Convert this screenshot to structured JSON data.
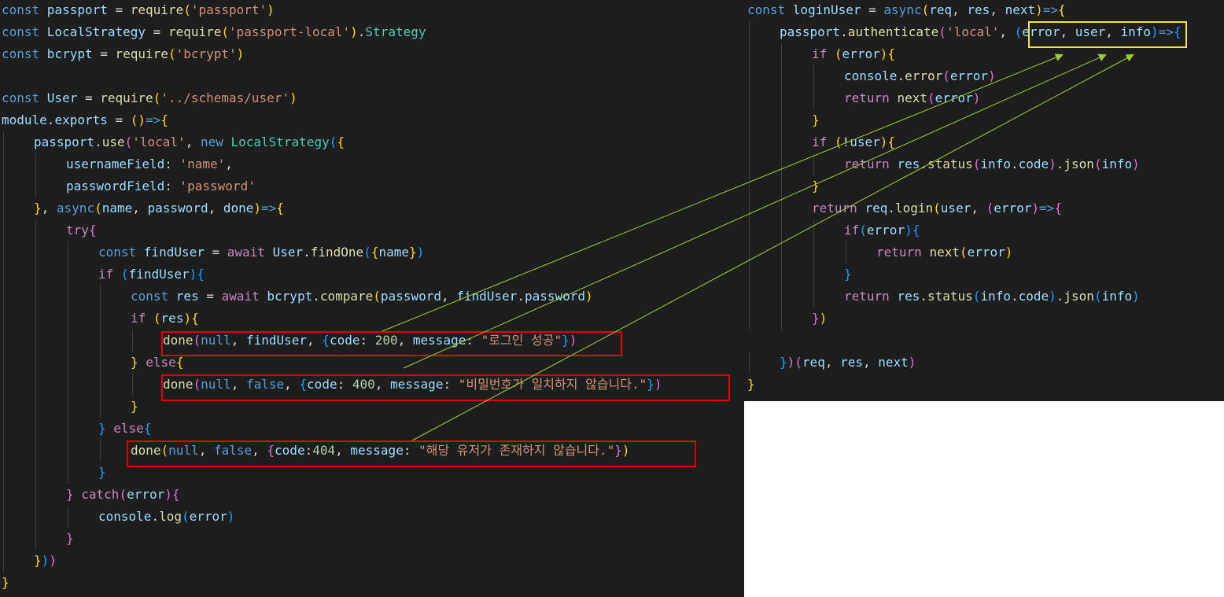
{
  "colors": {
    "background": "#1e1e1e",
    "keyword": "#569cd6",
    "control": "#c586c0",
    "variable": "#9cdcfe",
    "function": "#dcdcaa",
    "string": "#ce9178",
    "number": "#b5cea8",
    "class": "#4ec9b0",
    "plain": "#d4d4d4",
    "bracket1": "#ffd700",
    "bracket2": "#da70d6",
    "bracket3": "#179fff",
    "highlight_red": "#e00000",
    "highlight_yellow": "#f2e632",
    "arrow": "#9acd32"
  },
  "left_code": [
    {
      "indent": 0,
      "tokens": [
        [
          "const ",
          "k"
        ],
        [
          "passport",
          "v"
        ],
        [
          " = ",
          "p"
        ],
        [
          "require",
          "f"
        ],
        [
          "(",
          "b1"
        ],
        [
          "'passport'",
          "s"
        ],
        [
          ")",
          "b1"
        ]
      ]
    },
    {
      "indent": 0,
      "tokens": [
        [
          "const ",
          "k"
        ],
        [
          "LocalStrategy",
          "v"
        ],
        [
          " = ",
          "p"
        ],
        [
          "require",
          "f"
        ],
        [
          "(",
          "b1"
        ],
        [
          "'passport-local'",
          "s"
        ],
        [
          ")",
          "b1"
        ],
        [
          ".",
          "p"
        ],
        [
          "Strategy",
          "c"
        ]
      ]
    },
    {
      "indent": 0,
      "tokens": [
        [
          "const ",
          "k"
        ],
        [
          "bcrypt",
          "v"
        ],
        [
          " = ",
          "p"
        ],
        [
          "require",
          "f"
        ],
        [
          "(",
          "b1"
        ],
        [
          "'bcrypt'",
          "s"
        ],
        [
          ")",
          "b1"
        ]
      ]
    },
    {
      "indent": 0,
      "tokens": []
    },
    {
      "indent": 0,
      "tokens": [
        [
          "const ",
          "k"
        ],
        [
          "User",
          "v"
        ],
        [
          " = ",
          "p"
        ],
        [
          "require",
          "f"
        ],
        [
          "(",
          "b1"
        ],
        [
          "'../schemas/user'",
          "s"
        ],
        [
          ")",
          "b1"
        ]
      ]
    },
    {
      "indent": 0,
      "tokens": [
        [
          "module",
          "v"
        ],
        [
          ".",
          "p"
        ],
        [
          "exports",
          "v"
        ],
        [
          " = ",
          "p"
        ],
        [
          "()",
          "b1"
        ],
        [
          "=>",
          "k"
        ],
        [
          "{",
          "b1"
        ]
      ]
    },
    {
      "indent": 1,
      "tokens": [
        [
          "passport",
          "v"
        ],
        [
          ".",
          "p"
        ],
        [
          "use",
          "f"
        ],
        [
          "(",
          "b2"
        ],
        [
          "'local'",
          "s"
        ],
        [
          ", ",
          "p"
        ],
        [
          "new ",
          "k"
        ],
        [
          "LocalStrategy",
          "c"
        ],
        [
          "(",
          "b3"
        ],
        [
          "{",
          "b1"
        ]
      ]
    },
    {
      "indent": 2,
      "tokens": [
        [
          "usernameField",
          "v"
        ],
        [
          ": ",
          "p"
        ],
        [
          "'name'",
          "s"
        ],
        [
          ",",
          "p"
        ]
      ]
    },
    {
      "indent": 2,
      "tokens": [
        [
          "passwordField",
          "v"
        ],
        [
          ": ",
          "p"
        ],
        [
          "'password'",
          "s"
        ]
      ]
    },
    {
      "indent": 1,
      "tokens": [
        [
          "}",
          "b1"
        ],
        [
          ", ",
          "p"
        ],
        [
          "async",
          "k"
        ],
        [
          "(",
          "b1"
        ],
        [
          "name",
          "v"
        ],
        [
          ", ",
          "p"
        ],
        [
          "password",
          "v"
        ],
        [
          ", ",
          "p"
        ],
        [
          "done",
          "v"
        ],
        [
          ")",
          "b1"
        ],
        [
          "=>",
          "k"
        ],
        [
          "{",
          "b1"
        ]
      ]
    },
    {
      "indent": 2,
      "tokens": [
        [
          "try",
          "t"
        ],
        [
          "{",
          "b2"
        ]
      ]
    },
    {
      "indent": 3,
      "tokens": [
        [
          "const ",
          "k"
        ],
        [
          "findUser",
          "v"
        ],
        [
          " = ",
          "p"
        ],
        [
          "await ",
          "t"
        ],
        [
          "User",
          "v"
        ],
        [
          ".",
          "p"
        ],
        [
          "findOne",
          "f"
        ],
        [
          "(",
          "b3"
        ],
        [
          "{",
          "b1"
        ],
        [
          "name",
          "v"
        ],
        [
          "}",
          "b1"
        ],
        [
          ")",
          "b3"
        ]
      ]
    },
    {
      "indent": 3,
      "tokens": [
        [
          "if ",
          "t"
        ],
        [
          "(",
          "b3"
        ],
        [
          "findUser",
          "v"
        ],
        [
          ")",
          "b3"
        ],
        [
          "{",
          "b3"
        ]
      ]
    },
    {
      "indent": 4,
      "tokens": [
        [
          "const ",
          "k"
        ],
        [
          "res",
          "v"
        ],
        [
          " = ",
          "p"
        ],
        [
          "await ",
          "t"
        ],
        [
          "bcrypt",
          "v"
        ],
        [
          ".",
          "p"
        ],
        [
          "compare",
          "f"
        ],
        [
          "(",
          "b1"
        ],
        [
          "password",
          "v"
        ],
        [
          ", ",
          "p"
        ],
        [
          "findUser",
          "v"
        ],
        [
          ".",
          "p"
        ],
        [
          "password",
          "v"
        ],
        [
          ")",
          "b1"
        ]
      ]
    },
    {
      "indent": 4,
      "tokens": [
        [
          "if ",
          "t"
        ],
        [
          "(",
          "b1"
        ],
        [
          "res",
          "v"
        ],
        [
          ")",
          "b1"
        ],
        [
          "{",
          "b1"
        ]
      ]
    },
    {
      "indent": 5,
      "tokens": [
        [
          "done",
          "f"
        ],
        [
          "(",
          "b2"
        ],
        [
          "null",
          "k"
        ],
        [
          ", ",
          "p"
        ],
        [
          "findUser",
          "v"
        ],
        [
          ", ",
          "p"
        ],
        [
          "{",
          "b3"
        ],
        [
          "code",
          "v"
        ],
        [
          ": ",
          "p"
        ],
        [
          "200",
          "n"
        ],
        [
          ", ",
          "p"
        ],
        [
          "message",
          "v"
        ],
        [
          ": ",
          "p"
        ],
        [
          "\"로그인 성공\"",
          "s"
        ],
        [
          "}",
          "b3"
        ],
        [
          ")",
          "b2"
        ]
      ]
    },
    {
      "indent": 4,
      "tokens": [
        [
          "}",
          "b1"
        ],
        [
          " else",
          "t"
        ],
        [
          "{",
          "b1"
        ]
      ]
    },
    {
      "indent": 5,
      "tokens": [
        [
          "done",
          "f"
        ],
        [
          "(",
          "b2"
        ],
        [
          "null",
          "k"
        ],
        [
          ", ",
          "p"
        ],
        [
          "false",
          "k"
        ],
        [
          ", ",
          "p"
        ],
        [
          "{",
          "b3"
        ],
        [
          "code",
          "v"
        ],
        [
          ": ",
          "p"
        ],
        [
          "400",
          "n"
        ],
        [
          ", ",
          "p"
        ],
        [
          "message",
          "v"
        ],
        [
          ": ",
          "p"
        ],
        [
          "\"비밀번호가 일치하지 않습니다.\"",
          "s"
        ],
        [
          "}",
          "b3"
        ],
        [
          ")",
          "b2"
        ]
      ]
    },
    {
      "indent": 4,
      "tokens": [
        [
          "}",
          "b1"
        ]
      ]
    },
    {
      "indent": 3,
      "tokens": [
        [
          "}",
          "b3"
        ],
        [
          " else",
          "t"
        ],
        [
          "{",
          "b3"
        ]
      ]
    },
    {
      "indent": 4,
      "tokens": [
        [
          "done",
          "f"
        ],
        [
          "(",
          "b1"
        ],
        [
          "null",
          "k"
        ],
        [
          ", ",
          "p"
        ],
        [
          "false",
          "k"
        ],
        [
          ", ",
          "p"
        ],
        [
          "{",
          "b2"
        ],
        [
          "code",
          "v"
        ],
        [
          ":",
          "p"
        ],
        [
          "404",
          "n"
        ],
        [
          ", ",
          "p"
        ],
        [
          "message",
          "v"
        ],
        [
          ": ",
          "p"
        ],
        [
          "\"해당 유저가 존재하지 않습니다.\"",
          "s"
        ],
        [
          "}",
          "b2"
        ],
        [
          ")",
          "b1"
        ]
      ]
    },
    {
      "indent": 3,
      "tokens": [
        [
          "}",
          "b3"
        ]
      ]
    },
    {
      "indent": 2,
      "tokens": [
        [
          "}",
          "b2"
        ],
        [
          " catch",
          "t"
        ],
        [
          "(",
          "b2"
        ],
        [
          "error",
          "v"
        ],
        [
          ")",
          "b2"
        ],
        [
          "{",
          "b2"
        ]
      ]
    },
    {
      "indent": 3,
      "tokens": [
        [
          "console",
          "v"
        ],
        [
          ".",
          "p"
        ],
        [
          "log",
          "f"
        ],
        [
          "(",
          "b3"
        ],
        [
          "error",
          "v"
        ],
        [
          ")",
          "b3"
        ]
      ]
    },
    {
      "indent": 2,
      "tokens": [
        [
          "}",
          "b2"
        ]
      ]
    },
    {
      "indent": 1,
      "tokens": [
        [
          "}",
          "b1"
        ],
        [
          ")",
          "b3"
        ],
        [
          ")",
          "b2"
        ]
      ]
    },
    {
      "indent": 0,
      "tokens": [
        [
          "}",
          "b1"
        ]
      ]
    }
  ],
  "right_code": [
    {
      "indent": 0,
      "tokens": [
        [
          "const ",
          "k"
        ],
        [
          "loginUser",
          "v"
        ],
        [
          " = ",
          "p"
        ],
        [
          "async",
          "k"
        ],
        [
          "(",
          "b1"
        ],
        [
          "req",
          "v"
        ],
        [
          ", ",
          "p"
        ],
        [
          "res",
          "v"
        ],
        [
          ", ",
          "p"
        ],
        [
          "next",
          "v"
        ],
        [
          ")",
          "b1"
        ],
        [
          "=>",
          "k"
        ],
        [
          "{",
          "b1"
        ]
      ]
    },
    {
      "indent": 1,
      "tokens": [
        [
          "passport",
          "v"
        ],
        [
          ".",
          "p"
        ],
        [
          "authenticate",
          "f"
        ],
        [
          "(",
          "b2"
        ],
        [
          "'local'",
          "s"
        ],
        [
          ", ",
          "p"
        ],
        [
          "(",
          "b3"
        ],
        [
          "error",
          "v"
        ],
        [
          ", ",
          "p"
        ],
        [
          "user",
          "v"
        ],
        [
          ", ",
          "p"
        ],
        [
          "info",
          "v"
        ],
        [
          ")",
          "b3"
        ],
        [
          "=>",
          "k"
        ],
        [
          "{",
          "b3"
        ]
      ]
    },
    {
      "indent": 2,
      "tokens": [
        [
          "if ",
          "t"
        ],
        [
          "(",
          "b1"
        ],
        [
          "error",
          "v"
        ],
        [
          ")",
          "b1"
        ],
        [
          "{",
          "b1"
        ]
      ]
    },
    {
      "indent": 3,
      "tokens": [
        [
          "console",
          "v"
        ],
        [
          ".",
          "p"
        ],
        [
          "error",
          "f"
        ],
        [
          "(",
          "b2"
        ],
        [
          "error",
          "v"
        ],
        [
          ")",
          "b2"
        ]
      ]
    },
    {
      "indent": 3,
      "tokens": [
        [
          "return ",
          "t"
        ],
        [
          "next",
          "f"
        ],
        [
          "(",
          "b2"
        ],
        [
          "error",
          "v"
        ],
        [
          ")",
          "b2"
        ]
      ]
    },
    {
      "indent": 2,
      "tokens": [
        [
          "}",
          "b1"
        ]
      ]
    },
    {
      "indent": 2,
      "tokens": [
        [
          "if ",
          "t"
        ],
        [
          "(",
          "b1"
        ],
        [
          "!",
          "p"
        ],
        [
          "user",
          "v"
        ],
        [
          ")",
          "b1"
        ],
        [
          "{",
          "b1"
        ]
      ]
    },
    {
      "indent": 3,
      "tokens": [
        [
          "return ",
          "t"
        ],
        [
          "res",
          "v"
        ],
        [
          ".",
          "p"
        ],
        [
          "status",
          "f"
        ],
        [
          "(",
          "b2"
        ],
        [
          "info",
          "v"
        ],
        [
          ".",
          "p"
        ],
        [
          "code",
          "v"
        ],
        [
          ")",
          "b2"
        ],
        [
          ".",
          "p"
        ],
        [
          "json",
          "f"
        ],
        [
          "(",
          "b2"
        ],
        [
          "info",
          "v"
        ],
        [
          ")",
          "b2"
        ]
      ]
    },
    {
      "indent": 2,
      "tokens": [
        [
          "}",
          "b1"
        ]
      ]
    },
    {
      "indent": 2,
      "tokens": [
        [
          "return ",
          "t"
        ],
        [
          "req",
          "v"
        ],
        [
          ".",
          "p"
        ],
        [
          "login",
          "f"
        ],
        [
          "(",
          "b1"
        ],
        [
          "user",
          "v"
        ],
        [
          ", ",
          "p"
        ],
        [
          "(",
          "b2"
        ],
        [
          "error",
          "v"
        ],
        [
          ")",
          "b2"
        ],
        [
          "=>",
          "k"
        ],
        [
          "{",
          "b2"
        ]
      ]
    },
    {
      "indent": 3,
      "tokens": [
        [
          "if",
          "t"
        ],
        [
          "(",
          "b3"
        ],
        [
          "error",
          "v"
        ],
        [
          ")",
          "b3"
        ],
        [
          "{",
          "b3"
        ]
      ]
    },
    {
      "indent": 4,
      "tokens": [
        [
          "return ",
          "t"
        ],
        [
          "next",
          "f"
        ],
        [
          "(",
          "b1"
        ],
        [
          "error",
          "v"
        ],
        [
          ")",
          "b1"
        ]
      ]
    },
    {
      "indent": 3,
      "tokens": [
        [
          "}",
          "b3"
        ]
      ]
    },
    {
      "indent": 3,
      "tokens": [
        [
          "return ",
          "t"
        ],
        [
          "res",
          "v"
        ],
        [
          ".",
          "p"
        ],
        [
          "status",
          "f"
        ],
        [
          "(",
          "b3"
        ],
        [
          "info",
          "v"
        ],
        [
          ".",
          "p"
        ],
        [
          "code",
          "v"
        ],
        [
          ")",
          "b3"
        ],
        [
          ".",
          "p"
        ],
        [
          "json",
          "f"
        ],
        [
          "(",
          "b3"
        ],
        [
          "info",
          "v"
        ],
        [
          ")",
          "b3"
        ]
      ]
    },
    {
      "indent": 2,
      "tokens": [
        [
          "}",
          "b2"
        ],
        [
          ")",
          "b1"
        ]
      ]
    },
    {
      "indent": 0,
      "tokens": []
    },
    {
      "indent": 1,
      "tokens": [
        [
          "}",
          "b3"
        ],
        [
          ")",
          "b2"
        ],
        [
          "(",
          "b2"
        ],
        [
          "req",
          "v"
        ],
        [
          ", ",
          "p"
        ],
        [
          "res",
          "v"
        ],
        [
          ", ",
          "p"
        ],
        [
          "next",
          "v"
        ],
        [
          ")",
          "b2"
        ]
      ]
    },
    {
      "indent": 0,
      "tokens": [
        [
          "}",
          "b1"
        ]
      ]
    }
  ]
}
